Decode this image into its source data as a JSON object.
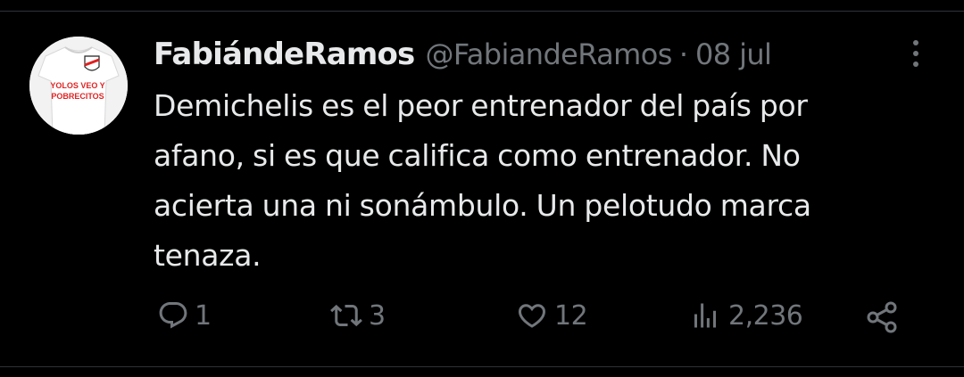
{
  "tweet": {
    "display_name": "FabiándeRamos",
    "handle": "@FabiandeRamos",
    "separator": "·",
    "date": "08 jul",
    "text": "Demichelis es el peor entrenador del país por\nafano, si es que califica como entrenador. No\nacierta una ni sonámbulo. Un pelotudo marca\ntenaza.",
    "avatar": {
      "shirt_text_line1": "YOLOS VEO Y",
      "shirt_text_line2": "POBRECITOS"
    }
  },
  "actions": {
    "reply": {
      "icon": "reply-icon",
      "count": "1"
    },
    "repost": {
      "icon": "repost-icon",
      "count": "3"
    },
    "like": {
      "icon": "heart-icon",
      "count": "12"
    },
    "views": {
      "icon": "views-icon",
      "count": "2,236"
    },
    "share": {
      "icon": "share-icon"
    }
  },
  "colors": {
    "background": "#000000",
    "text": "#e7e9ea",
    "secondary": "#71767b",
    "divider": "#2f3336"
  }
}
